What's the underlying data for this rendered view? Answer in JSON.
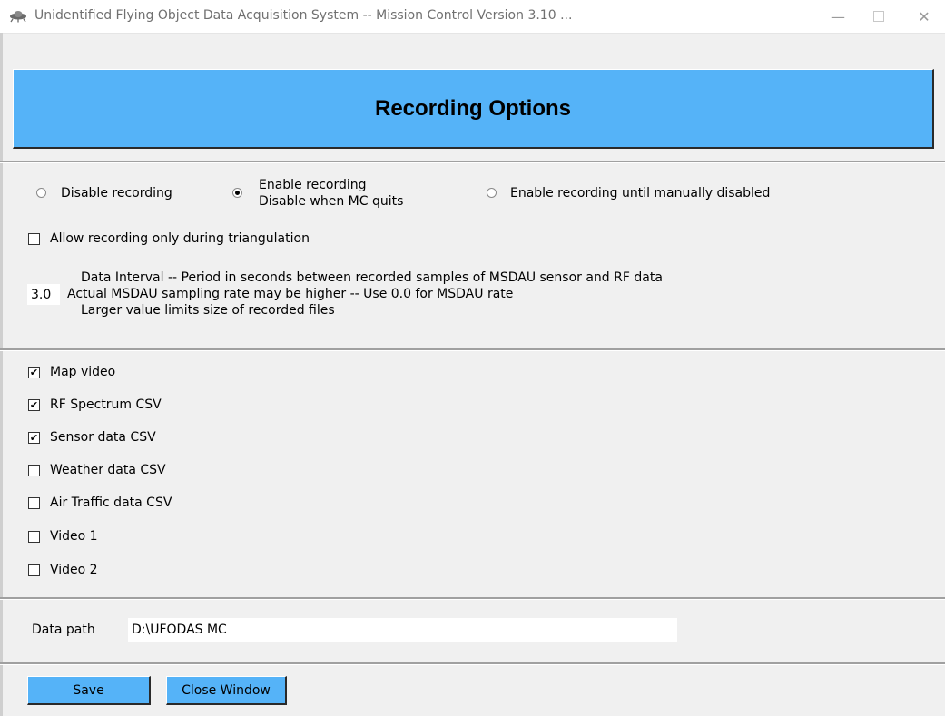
{
  "window": {
    "title": "Unidentified Flying Object Data Acquisition System -- Mission Control   Version 3.10 ...",
    "minimize_glyph": "—",
    "close_glyph": "✕",
    "app_icon": "ufo-icon"
  },
  "header": {
    "title": "Recording Options"
  },
  "recording_mode": {
    "options": [
      {
        "label": "Disable recording",
        "checked": false
      },
      {
        "label": "Enable recording",
        "sublabel": "Disable when MC quits",
        "checked": true
      },
      {
        "label": "Enable recording until manually disabled",
        "checked": false
      }
    ]
  },
  "triangulation_only": {
    "label": "Allow recording only during triangulation",
    "checked": false
  },
  "data_interval": {
    "value": "3.0",
    "lines": [
      "Data Interval -- Period in seconds between recorded samples of MSDAU sensor and RF data",
      "Actual MSDAU sampling rate may be higher -- Use 0.0 for MSDAU rate",
      "Larger value limits size of recorded files"
    ]
  },
  "outputs": [
    {
      "label": "Map video",
      "checked": true,
      "mark": "✔"
    },
    {
      "label": "RF Spectrum CSV",
      "checked": true,
      "mark": "✔"
    },
    {
      "label": "Sensor data CSV",
      "checked": true,
      "mark": "✔"
    },
    {
      "label": "Weather data CSV",
      "checked": false,
      "mark": ""
    },
    {
      "label": "Air Traffic data CSV",
      "checked": false,
      "mark": ""
    },
    {
      "label": "Video 1",
      "checked": false,
      "mark": ""
    },
    {
      "label": "Video 2",
      "checked": false,
      "mark": ""
    }
  ],
  "data_path": {
    "label": "Data path",
    "value": "D:\\UFODAS MC"
  },
  "buttons": {
    "save": "Save",
    "close": "Close Window"
  },
  "colors": {
    "accent": "#55b3f8",
    "background": "#f0f0f0"
  }
}
